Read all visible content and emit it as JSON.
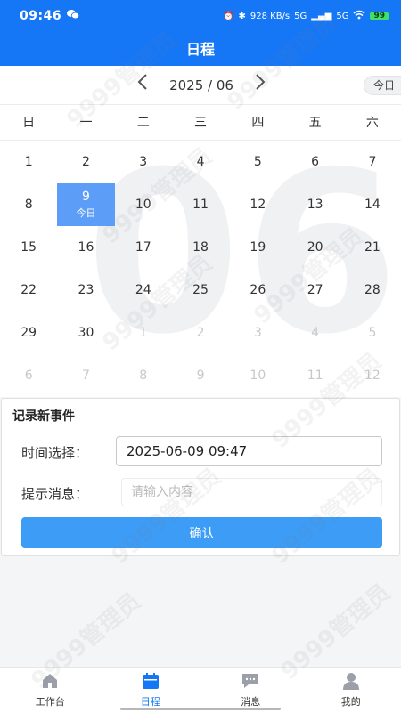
{
  "status_bar": {
    "time": "09:46",
    "network": "928 KB/s",
    "signal1": "5G",
    "signal2": "5G",
    "battery": "99"
  },
  "header": {
    "title": "日程"
  },
  "calendar": {
    "month_label": "2025 / 06",
    "today_label": "今日",
    "watermark_month": "06",
    "weekdays": [
      "日",
      "一",
      "二",
      "三",
      "四",
      "五",
      "六"
    ],
    "days": [
      {
        "num": "1"
      },
      {
        "num": "2"
      },
      {
        "num": "3"
      },
      {
        "num": "4"
      },
      {
        "num": "5"
      },
      {
        "num": "6"
      },
      {
        "num": "7"
      },
      {
        "num": "8"
      },
      {
        "num": "9",
        "sub": "今日",
        "selected": true
      },
      {
        "num": "10"
      },
      {
        "num": "11"
      },
      {
        "num": "12"
      },
      {
        "num": "13"
      },
      {
        "num": "14"
      },
      {
        "num": "15"
      },
      {
        "num": "16"
      },
      {
        "num": "17"
      },
      {
        "num": "18"
      },
      {
        "num": "19"
      },
      {
        "num": "20"
      },
      {
        "num": "21"
      },
      {
        "num": "22"
      },
      {
        "num": "23"
      },
      {
        "num": "24"
      },
      {
        "num": "25"
      },
      {
        "num": "26"
      },
      {
        "num": "27"
      },
      {
        "num": "28"
      },
      {
        "num": "29"
      },
      {
        "num": "30"
      },
      {
        "num": "1",
        "other": true
      },
      {
        "num": "2",
        "other": true
      },
      {
        "num": "3",
        "other": true
      },
      {
        "num": "4",
        "other": true
      },
      {
        "num": "5",
        "other": true
      },
      {
        "num": "6",
        "other": true
      },
      {
        "num": "7",
        "other": true
      },
      {
        "num": "8",
        "other": true
      },
      {
        "num": "9",
        "other": true
      },
      {
        "num": "10",
        "other": true
      },
      {
        "num": "11",
        "other": true
      },
      {
        "num": "12",
        "other": true
      }
    ]
  },
  "event_form": {
    "title": "记录新事件",
    "time_label": "时间选择：",
    "time_value": "2025-06-09 09:47",
    "message_label": "提示消息：",
    "message_placeholder": "请输入内容",
    "message_value": "",
    "confirm_label": "确认"
  },
  "watermark_text": "9999管理员",
  "tabs": [
    {
      "label": "工作台",
      "icon": "home-icon",
      "active": false
    },
    {
      "label": "日程",
      "icon": "calendar-icon",
      "active": true
    },
    {
      "label": "消息",
      "icon": "message-icon",
      "active": false
    },
    {
      "label": "我的",
      "icon": "user-icon",
      "active": false
    }
  ],
  "colors": {
    "primary": "#1677f6",
    "selected_day": "#5b9df7",
    "confirm_button": "#3d9cf5"
  }
}
